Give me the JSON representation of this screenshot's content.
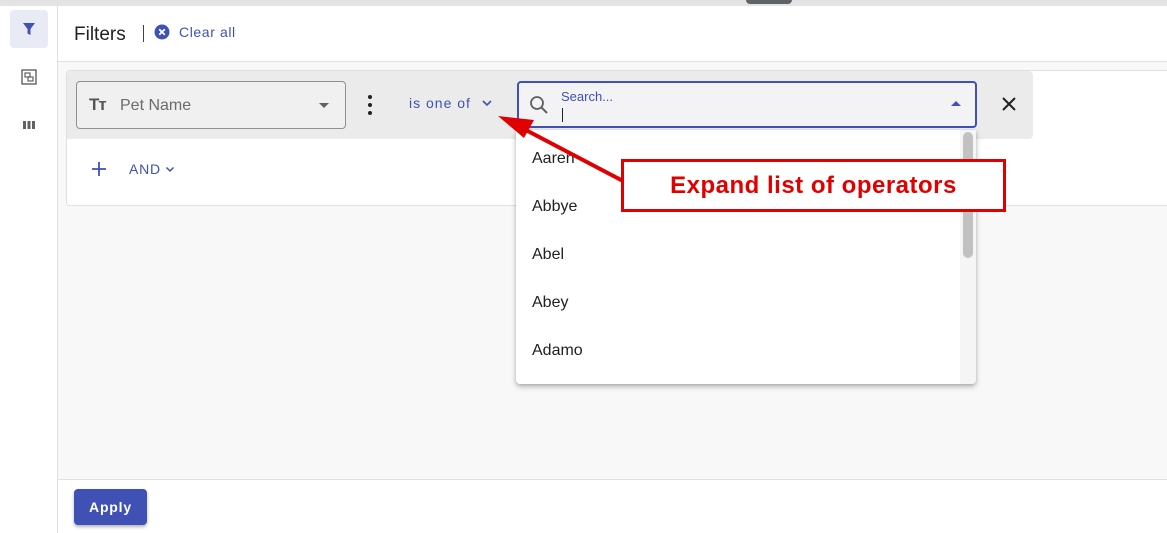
{
  "header": {
    "title": "Filters",
    "clear_all_label": "Clear all"
  },
  "rail": {
    "items": [
      {
        "icon": "filter-icon",
        "active": true
      },
      {
        "icon": "group-icon",
        "active": false
      },
      {
        "icon": "columns-icon",
        "active": false
      }
    ]
  },
  "filter": {
    "field_type_glyph": "Tт",
    "field_label": "Pet Name",
    "operator_label": "is one of",
    "value_placeholder": "Search...",
    "options": [
      "Aaren",
      "Abbye",
      "Abel",
      "Abey",
      "Adamo"
    ]
  },
  "add_row": {
    "plus": "+",
    "conjunction_label": "AND"
  },
  "footer": {
    "apply_label": "Apply"
  },
  "annotation": {
    "callout_text": "Expand list of operators"
  },
  "colors": {
    "accent": "#3f51b5",
    "annotation": "#e00000"
  }
}
